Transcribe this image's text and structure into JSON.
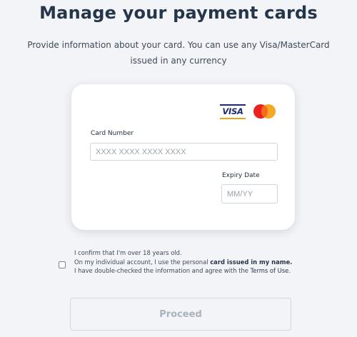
{
  "header": {
    "title": "Manage your payment cards",
    "subtitle_line1": "Provide information about your card. You can use any Visa/MasterCard",
    "subtitle_line2": "issued in any currency"
  },
  "card_form": {
    "brands": {
      "visa_text": "VISA",
      "visa_icon": "visa-logo",
      "mastercard_icon": "mastercard-logo"
    },
    "card_number_label": "Card Number",
    "card_number_value": "",
    "card_number_placeholder": "XXXX XXXX XXXX XXXX",
    "expiry_label": "Expiry Date",
    "expiry_value": "",
    "expiry_placeholder": "MM/YY"
  },
  "consent": {
    "checked": false,
    "line1": "I confirm that I'm over 18 years old.",
    "line2_prefix": "On my individual account, I use the personal ",
    "line2_bold": "card issued in my name.",
    "line3_prefix": "I have double-checked the information and agree with the ",
    "terms_link": "Terms of Use",
    "line3_suffix": "."
  },
  "proceed_label": "Proceed",
  "colors": {
    "page_bg": "#f3f4f7",
    "title": "#26364a",
    "visa_blue": "#1a2b74",
    "visa_gold": "#e8a21b",
    "mc_red": "#e9221e",
    "mc_orange": "#f6a21a",
    "disabled_text": "#a9b2bd"
  }
}
